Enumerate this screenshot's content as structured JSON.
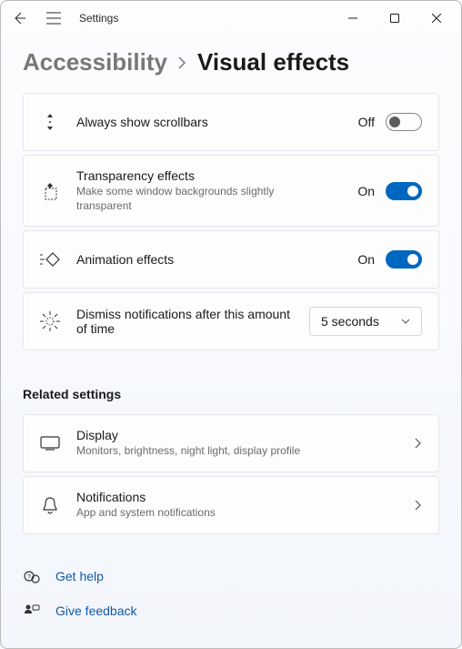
{
  "titlebar": {
    "title": "Settings"
  },
  "breadcrumb": {
    "parent": "Accessibility",
    "current": "Visual effects"
  },
  "settings": {
    "scrollbars": {
      "title": "Always show scrollbars",
      "state": "Off"
    },
    "transparency": {
      "title": "Transparency effects",
      "desc": "Make some window backgrounds slightly transparent",
      "state": "On"
    },
    "animation": {
      "title": "Animation effects",
      "state": "On"
    },
    "dismiss": {
      "title": "Dismiss notifications after this amount of time",
      "value": "5 seconds"
    }
  },
  "related": {
    "heading": "Related settings",
    "display": {
      "title": "Display",
      "desc": "Monitors, brightness, night light, display profile"
    },
    "notifications": {
      "title": "Notifications",
      "desc": "App and system notifications"
    }
  },
  "help": {
    "get_help": "Get help",
    "feedback": "Give feedback"
  }
}
